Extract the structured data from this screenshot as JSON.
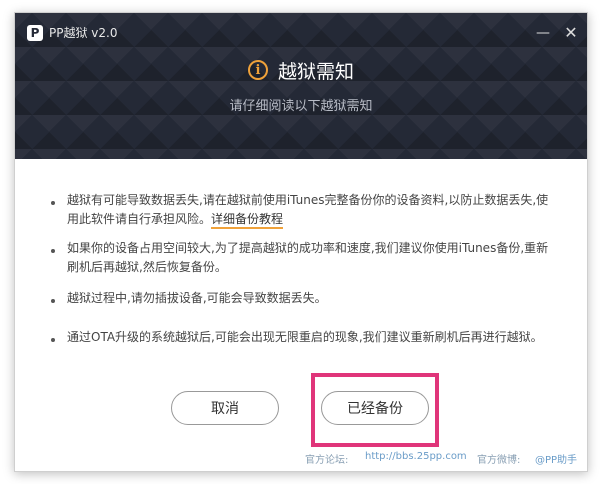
{
  "app": {
    "logo_char": "P",
    "title": "PP越狱 v2.0",
    "minimize_glyph": "—",
    "close_glyph": "✕"
  },
  "dialog": {
    "icon_char": "i",
    "title": "越狱需知",
    "subtitle": "请仔细阅读以下越狱需知"
  },
  "notes": [
    {
      "text": "越狱有可能导致数据丢失,请在越狱前使用iTunes完整备份你的设备资料,以防止数据丢失,使用此软件请自行承担风险。",
      "link": "详细备份教程"
    },
    {
      "text": "如果你的设备占用空间较大,为了提高越狱的成功率和速度,我们建议你使用iTunes备份,重新刷机后再越狱,然后恢复备份。"
    },
    {
      "text": "越狱过程中,请勿插拔设备,可能会导致数据丢失。"
    },
    {
      "text": "通过OTA升级的系统越狱后,可能会出现无限重启的现象,我们建议重新刷机后再进行越狱。"
    }
  ],
  "buttons": {
    "cancel": "取消",
    "confirm": "已经备份"
  },
  "footer": {
    "forum_label": "官方论坛:",
    "forum_link": "http://bbs.25pp.com",
    "weibo_label": "官方微博:",
    "weibo_link": "@PP助手"
  },
  "colors": {
    "header_bg": "#242936",
    "accent": "#f0a23a",
    "highlight": "#e0357a",
    "link": "#6a9cc8"
  },
  "icons": {
    "logo": "pp-logo-icon",
    "info": "info-circle-icon",
    "minimize": "minimize-icon",
    "close": "close-icon"
  }
}
